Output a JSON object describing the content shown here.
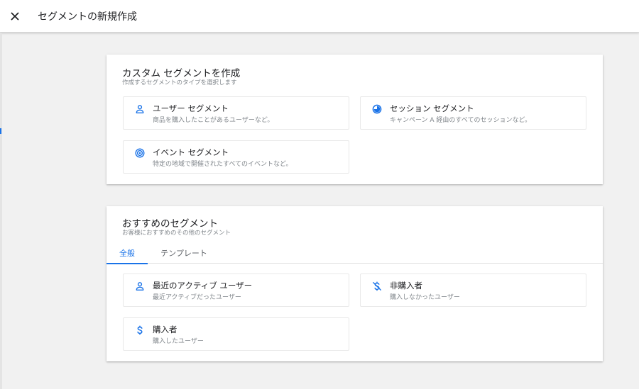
{
  "header": {
    "title": "セグメントの新規作成",
    "close_icon": "close-icon"
  },
  "custom": {
    "title": "カスタム セグメントを作成",
    "subtitle": "作成するセグメントのタイプを選択します",
    "options": [
      {
        "title": "ユーザー セグメント",
        "desc": "商品を購入したことがあるユーザーなど。",
        "icon": "person-icon"
      },
      {
        "title": "セッション セグメント",
        "desc": "キャンペーン A 経由のすべてのセッションなど。",
        "icon": "session-icon"
      },
      {
        "title": "イベント セグメント",
        "desc": "特定の地域で開催されたすべてのイベントなど。",
        "icon": "event-icon"
      }
    ]
  },
  "suggested": {
    "title": "おすすめのセグメント",
    "subtitle": "お客様におすすめのその他のセグメント",
    "tabs": [
      {
        "label": "全般",
        "active": true
      },
      {
        "label": "テンプレート",
        "active": false
      }
    ],
    "options": [
      {
        "title": "最近のアクティブ ユーザー",
        "desc": "最近アクティブだったユーザー",
        "icon": "person-icon"
      },
      {
        "title": "非購入者",
        "desc": "購入しなかったユーザー",
        "icon": "money-off-icon"
      },
      {
        "title": "購入者",
        "desc": "購入したユーザー",
        "icon": "dollar-icon"
      }
    ]
  },
  "colors": {
    "accent": "#1a73e8",
    "background": "#f1f1f1",
    "card": "#ffffff",
    "secondary_text": "#80868b"
  }
}
